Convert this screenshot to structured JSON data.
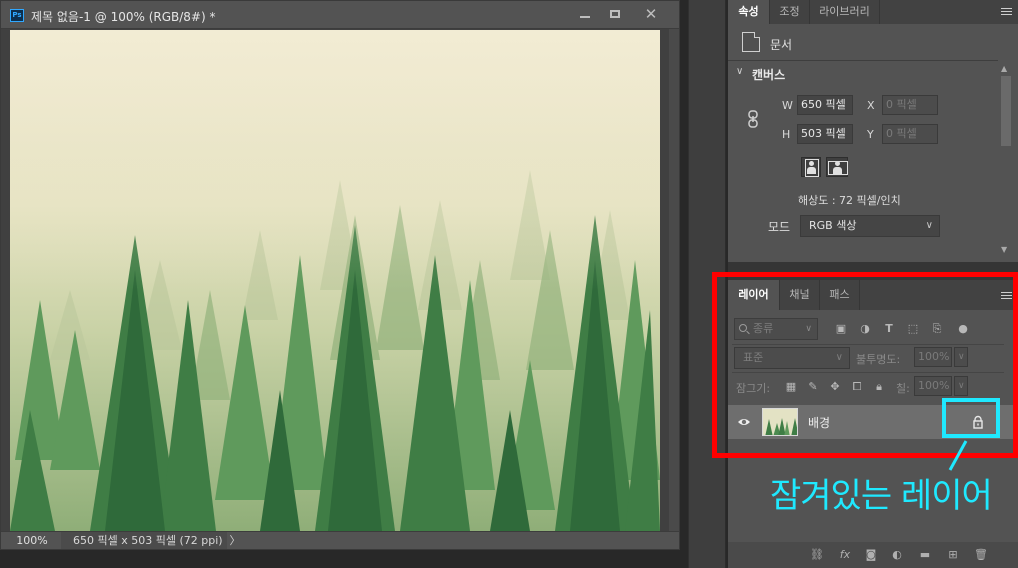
{
  "document": {
    "title": "제목 없음-1 @ 100% (RGB/8#) *",
    "app_badge": "Ps",
    "zoom": "100%",
    "info": "650 픽셀 x 503 픽셀 (72 ppi)",
    "status_arrow": "〉"
  },
  "properties_panel": {
    "tabs": [
      "속성",
      "조정",
      "라이브러리"
    ],
    "active_tab": "속성",
    "doc_label": "문서",
    "section_title": "캔버스",
    "width_label": "W",
    "width_value": "650 픽셀",
    "height_label": "H",
    "height_value": "503 픽셀",
    "x_label": "X",
    "x_placeholder": "0 픽셀",
    "y_label": "Y",
    "y_placeholder": "0 픽셀",
    "resolution": "해상도 : 72 픽셀/인치",
    "mode_label": "모드",
    "mode_value": "RGB 색상"
  },
  "layers_panel": {
    "tabs": [
      "레이어",
      "채널",
      "패스"
    ],
    "active_tab": "레이어",
    "filter_kind": "종류",
    "blend_mode": "표준",
    "opacity_label": "불투명도:",
    "opacity_value": "100%",
    "lock_label": "잠그기:",
    "fill_label": "칠:",
    "fill_value": "100%",
    "layers": [
      {
        "name": "배경",
        "visible": true,
        "locked": true
      }
    ]
  },
  "annotation": {
    "callout_text": "잠겨있는 레이어",
    "highlight_color": "#ff0000",
    "callout_color": "#1fe9ff"
  },
  "icons": {
    "window": [
      "minimize-icon",
      "maximize-icon",
      "close-icon"
    ],
    "layer_filters": [
      "pixel-filter-icon",
      "adjustment-filter-icon",
      "type-filter-icon",
      "shape-filter-icon",
      "smart-object-filter-icon",
      "filter-toggle-icon"
    ],
    "locks": [
      "lock-transparent-icon",
      "lock-paint-icon",
      "lock-position-icon",
      "lock-artboard-icon",
      "lock-all-icon"
    ],
    "bottom": [
      "link-layers-icon",
      "fx-icon",
      "mask-icon",
      "adjustment-layer-icon",
      "group-icon",
      "new-layer-icon",
      "trash-icon"
    ]
  }
}
